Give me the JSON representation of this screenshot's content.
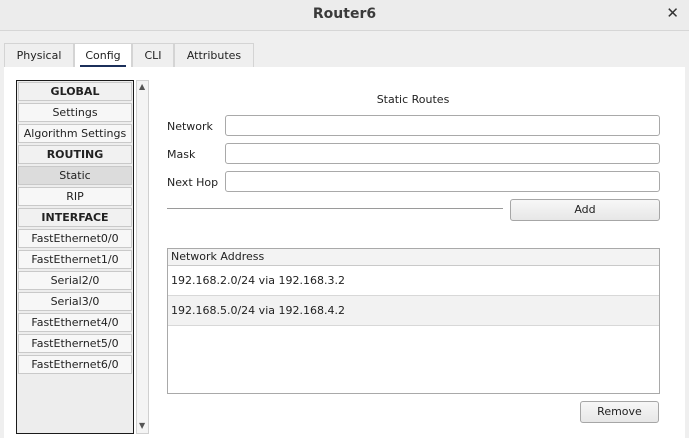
{
  "window": {
    "title": "Router6",
    "close_glyph": "✕"
  },
  "tabs": [
    {
      "label": "Physical"
    },
    {
      "label": "Config"
    },
    {
      "label": "CLI"
    },
    {
      "label": "Attributes"
    }
  ],
  "sidebar": {
    "items": [
      {
        "label": "GLOBAL"
      },
      {
        "label": "Settings"
      },
      {
        "label": "Algorithm Settings"
      },
      {
        "label": "ROUTING"
      },
      {
        "label": "Static"
      },
      {
        "label": "RIP"
      },
      {
        "label": "INTERFACE"
      },
      {
        "label": "FastEthernet0/0"
      },
      {
        "label": "FastEthernet1/0"
      },
      {
        "label": "Serial2/0"
      },
      {
        "label": "Serial3/0"
      },
      {
        "label": "FastEthernet4/0"
      },
      {
        "label": "FastEthernet5/0"
      },
      {
        "label": "FastEthernet6/0"
      }
    ],
    "selected": "Static"
  },
  "static_routes": {
    "title": "Static Routes",
    "network_label": "Network",
    "network_value": "",
    "mask_label": "Mask",
    "mask_value": "",
    "next_hop_label": "Next Hop",
    "next_hop_value": "",
    "add_label": "Add",
    "table_header": "Network Address",
    "routes": [
      "192.168.2.0/24 via 192.168.3.2",
      "192.168.5.0/24 via 192.168.4.2"
    ],
    "remove_label": "Remove"
  },
  "colors": {
    "tab_underline": "#1b2f5a",
    "selected_item": "#dcdcdc"
  }
}
